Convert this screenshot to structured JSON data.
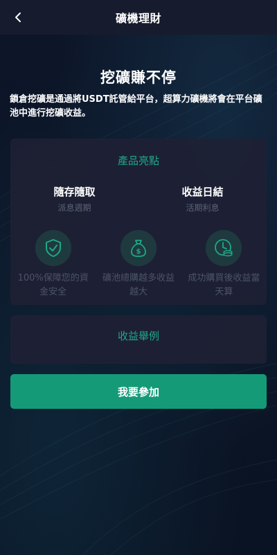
{
  "header": {
    "title": "礦機理財",
    "back_icon": "chevron-left-icon"
  },
  "hero": {
    "title": "挖礦賺不停",
    "description": "鎖倉挖礦是通過將USDT託管給平台，超算力礦機將會在平台礦池中進行挖礦收益。"
  },
  "features": {
    "title": "產品亮點",
    "columns": [
      {
        "main": "隨存隨取",
        "sub": "派息週期"
      },
      {
        "main": "收益日結",
        "sub": "活期利息"
      }
    ],
    "icons": [
      {
        "icon": "shield-check-icon",
        "caption": "100%保障您的資金安全"
      },
      {
        "icon": "money-bag-icon",
        "caption": "礦池總購越多收益越大"
      },
      {
        "icon": "clock-coins-icon",
        "caption": "成功購買後收益當天算"
      }
    ]
  },
  "example": {
    "title": "收益舉例"
  },
  "cta": {
    "label": "我要參加"
  },
  "colors": {
    "accent": "#1fa888",
    "button": "#159a78",
    "card": "#1e2134",
    "header": "#171b2e",
    "muted": "#4c5468"
  }
}
